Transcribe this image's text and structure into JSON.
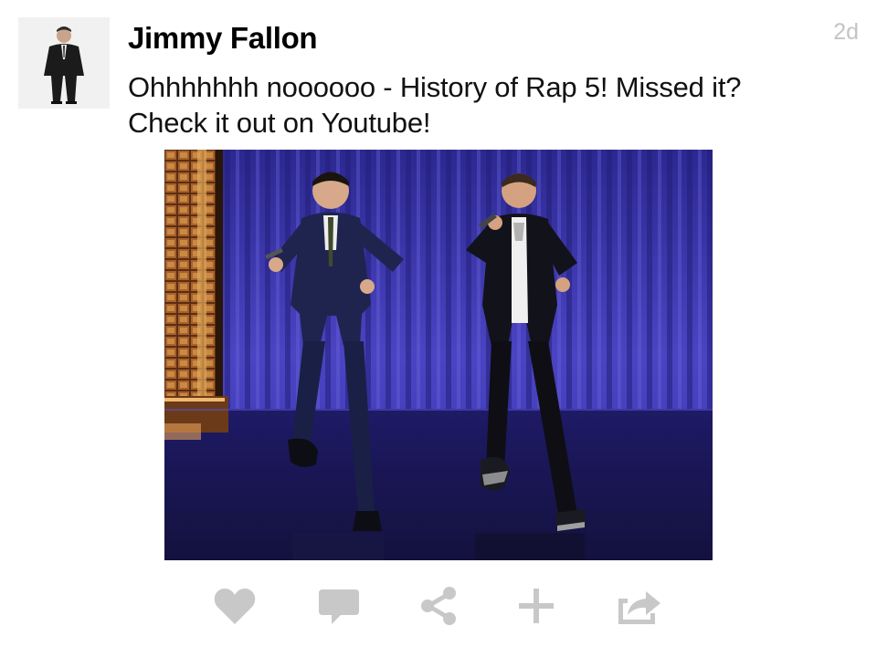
{
  "post": {
    "author": "Jimmy Fallon",
    "timestamp": "2d",
    "text_lines": [
      "Ohhhhhhh noooooo - History of Rap 5! Missed it?",
      "Check it out on Youtube!"
    ]
  },
  "actions": [
    {
      "icon": "heart-icon"
    },
    {
      "icon": "comment-icon"
    },
    {
      "icon": "share-icon"
    },
    {
      "icon": "plus-icon"
    },
    {
      "icon": "forward-icon"
    }
  ],
  "colors": {
    "timestamp": "#c4c4c4",
    "action_icon": "#c8c8c8",
    "curtain": "#3a34a8"
  }
}
